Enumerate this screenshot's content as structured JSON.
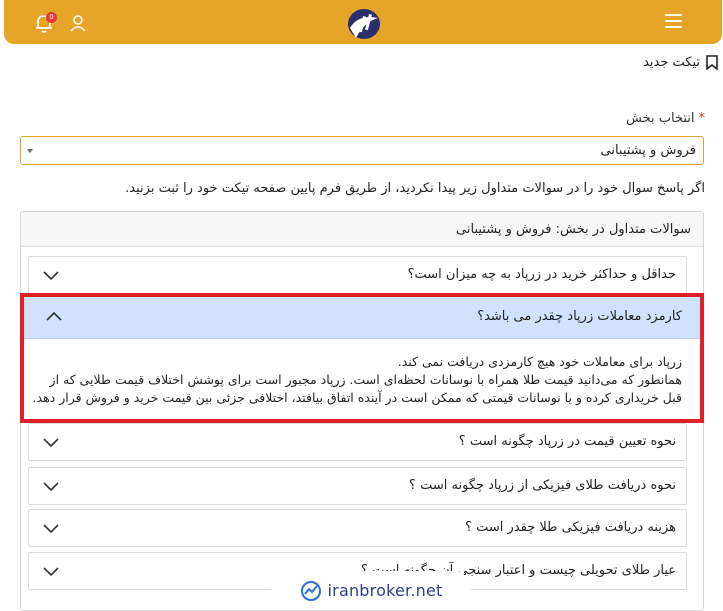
{
  "header": {
    "notifications_count": "0",
    "brand_color": "#e6a429"
  },
  "page": {
    "title": "تیکت جدید"
  },
  "form": {
    "section_label": "انتخاب بخش",
    "required_mark": "*",
    "section_value": "فروش و پشتیبانی"
  },
  "info_text": "اگر پاسخ سوال خود را در سوالات متداول زیر پیدا نکردید، از طریق فرم پایین صفحه تیکت خود را ثبت بزنید.",
  "faq": {
    "heading": "سوالات متداول در بخش: فروش و پشتیبانی",
    "items": [
      {
        "question": "حداقل و حداکثر خرید در زرپاد به چه میزان است؟"
      },
      {
        "question": "کارمزد معاملات زرپاد چقدر می باشد؟",
        "answer_lines": [
          "زرپاد برای معاملات خود هیچ کارمزدی دریافت نمی کند.",
          "همانطور که می‌دانید قیمت طلا همراه با نوسانات لحظه‌ای است. زرپاد مجبور است برای پوشش اختلاف قیمت طلایی که از",
          "قبل خریداری کرده و یا نوسانات قیمتی که ممکن است در آینده اتفاق بیافتد، اختلافی جزئی بین قیمت خرید و فروش قرار دهد."
        ]
      },
      {
        "question": "نحوه تعیین قیمت در زرپاد چگونه است ؟"
      },
      {
        "question": "نحوه دریافت طلای فیزیکی از زرپاد چگونه است ؟"
      },
      {
        "question": "هزینه دریافت فیزیکی طلا چقدر است ؟"
      },
      {
        "question": "عیار طلای تحویلی چیست و اعتبار سنجی آن چگونه است ؟"
      }
    ]
  },
  "watermark": "iranbroker.net"
}
